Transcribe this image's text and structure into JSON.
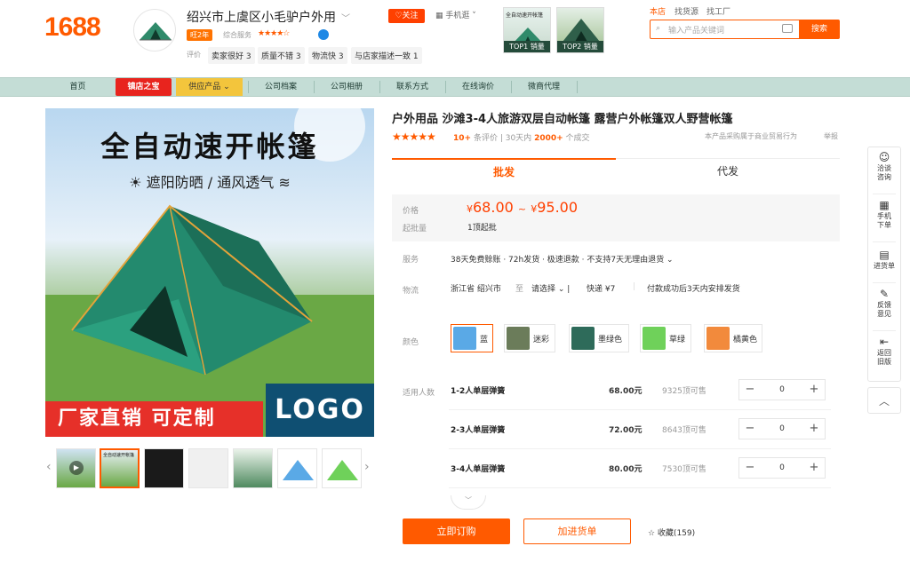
{
  "header": {
    "logo": "1688",
    "shop_name": "绍兴市上虞区小毛驴户外用",
    "follow_label": "关注",
    "mobile_label": "手机逛",
    "years_badge": "旺2年",
    "rating_label": "综合服务",
    "rating_stars": "★★★★☆",
    "eval_label": "评价",
    "eval_tags": [
      "卖家很好 3",
      "质量不错 3",
      "物流快 3",
      "与店家描述一致 1"
    ],
    "top_products": [
      {
        "caption": "TOP1 销量",
        "mini_title": "全自动速开帐篷"
      },
      {
        "caption": "TOP2 销量",
        "mini_title": ""
      }
    ],
    "top_nav": [
      "本店",
      "找货源",
      "找工厂"
    ],
    "search_placeholder": "输入产品关键词",
    "search_button": "搜索"
  },
  "navbar": {
    "items": [
      "首页",
      "镇店之宝",
      "供应产品",
      "公司档案",
      "公司相册",
      "联系方式",
      "在线询价",
      "微商代理"
    ]
  },
  "main_image": {
    "title": "全自动速开帐篷",
    "subtitle": "☀ 遮阳防晒 / 通风透气 ≋",
    "banner_red": "厂家直销 可定制",
    "banner_logo": "LOGO",
    "thumb_count": 7,
    "thumb_mini_title": "全自动速开帐篷"
  },
  "product": {
    "title": "户外用品 沙滩3-4人旅游双层自动帐篷 露营户外帐篷双人野营帐篷",
    "stars": "★★★★★",
    "review_count": "10+",
    "review_label": "条评价",
    "sales_prefix": "30天内",
    "sales_count": "2000+",
    "sales_suffix": "个成交",
    "right_note": "本产品采购属于商业贸易行为",
    "report_label": "举报",
    "tabs": [
      "批发",
      "代发"
    ],
    "price_label": "价格",
    "price_low": "68.00",
    "price_high": "95.00",
    "currency": "¥",
    "moq_label": "起批量",
    "moq_value": "1顶起批",
    "service_label": "服务",
    "service_value": "38天免费赊账 · 72h发货 · 极速退款 · 不支持7天无理由退货",
    "logistics_label": "物流",
    "logistics_from": "浙江省 绍兴市",
    "logistics_to": "至",
    "logistics_select": "请选择",
    "logistics_express": "快递 ¥7",
    "logistics_note": "付款成功后3天内安排发货",
    "color_label": "颜色",
    "colors": [
      {
        "name": "蓝",
        "swatch": "#5aa9e6"
      },
      {
        "name": "迷彩",
        "swatch": "#6b7c5a"
      },
      {
        "name": "墨绿色",
        "swatch": "#2e6b5a"
      },
      {
        "name": "草绿",
        "swatch": "#6fd15a"
      },
      {
        "name": "橘黄色",
        "swatch": "#f28a3c"
      }
    ],
    "specs_label": "适用人数",
    "specs": [
      {
        "name": "1-2人单层弹簧",
        "price": "68.00元",
        "stock": "9325顶可售",
        "qty": "0"
      },
      {
        "name": "2-3人单层弹簧",
        "price": "72.00元",
        "stock": "8643顶可售",
        "qty": "0"
      },
      {
        "name": "3-4人单层弹簧",
        "price": "80.00元",
        "stock": "7530顶可售",
        "qty": "0"
      }
    ],
    "expand_label": "﹀",
    "order_button": "立即订购",
    "cart_button": "加进货单",
    "favorite_label": "☆ 收藏(159)"
  },
  "float_bar": {
    "items": [
      {
        "icon": "☺",
        "label": "洽谈\n咨询"
      },
      {
        "icon": "▦",
        "label": "手机\n下单"
      },
      {
        "icon": "▤",
        "label": "进货单"
      },
      {
        "icon": "✎",
        "label": "反馈\n意见"
      },
      {
        "icon": "⇤",
        "label": "返回\n旧版"
      }
    ],
    "top_icon": "︿"
  },
  "colors": {
    "brand": "#ff5a00",
    "nav_bg": "#c4ddd6"
  }
}
